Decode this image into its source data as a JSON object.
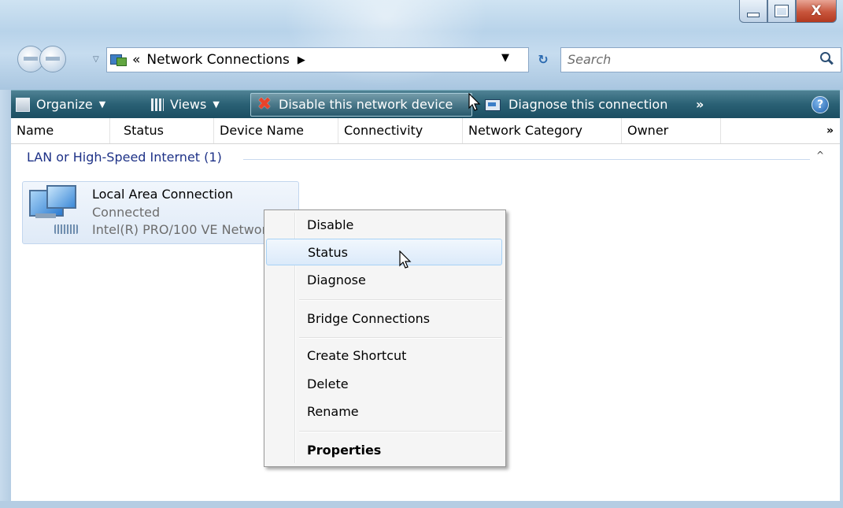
{
  "window": {
    "caption_buttons": {
      "minimize_icon": "minimize-icon",
      "maximize_icon": "maximize-icon",
      "close_icon": "close-icon",
      "close_glyph": "X"
    }
  },
  "address_bar": {
    "chevron": "«",
    "path": "Network Connections",
    "separator": "▶",
    "dropdown": "▼",
    "refresh_glyph": "⁴⁺"
  },
  "search": {
    "placeholder": "Search"
  },
  "toolbar": {
    "organize": "Organize",
    "views": "Views",
    "disable_device": "Disable this network device",
    "diagnose": "Diagnose this connection",
    "more": "»",
    "dropdown": "▼",
    "help_glyph": "?"
  },
  "columns": [
    "Name",
    "Status",
    "Device Name",
    "Connectivity",
    "Network Category",
    "Owner"
  ],
  "columns_more": "»",
  "group": {
    "title": "LAN or High-Speed Internet (1)",
    "toggle": "^"
  },
  "item": {
    "name": "Local Area Connection",
    "status": "Connected",
    "device": "Intel(R) PRO/100 VE Network Connection"
  },
  "context_menu": {
    "items": [
      {
        "label": "Disable"
      },
      {
        "label": "Status"
      },
      {
        "label": "Diagnose"
      },
      {
        "label": "Bridge Connections"
      },
      {
        "label": "Create Shortcut"
      },
      {
        "label": "Delete"
      },
      {
        "label": "Rename"
      },
      {
        "label": "Properties"
      }
    ],
    "highlighted": "Status",
    "default": "Properties"
  },
  "colors": {
    "toolbar": "#2a6074",
    "group_title": "#1e3287",
    "close_button": "#c8553c",
    "highlight_border": "#a8d2f5"
  }
}
